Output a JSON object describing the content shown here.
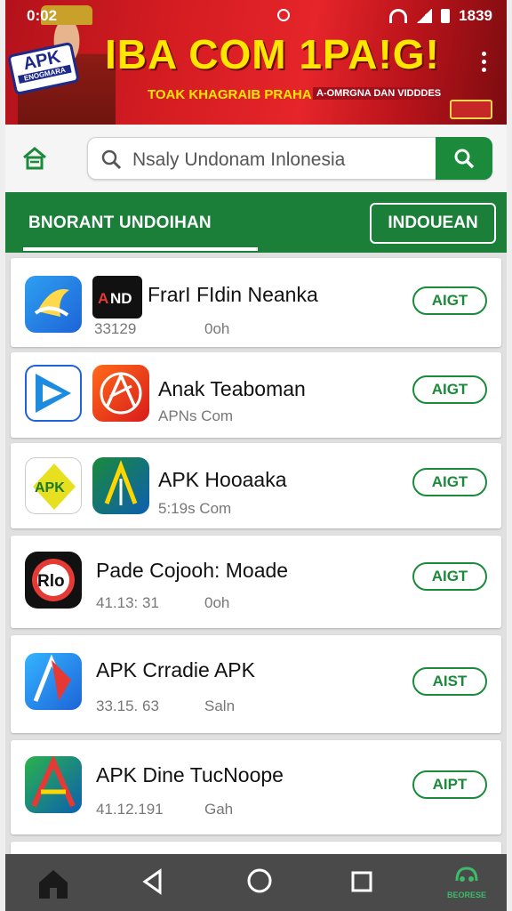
{
  "status_bar": {
    "time": "0:02",
    "clock_right": "1839"
  },
  "banner": {
    "logo_text": "APK",
    "logo_subtext": "ENOGMARA",
    "title": "IBA COM 1PA!G!",
    "subtitle": "TOAK KHAGRAIB PRAHA",
    "subtitle_right": "A-OMRGNA DAN VIDDDES"
  },
  "search": {
    "placeholder": "Nsaly Undonam Inlonesia"
  },
  "tabs": {
    "active_label": "BNORANT UNDOIHAN",
    "button_label": "INDOUEAN"
  },
  "apps": [
    {
      "name": "FrarI FIdin Neanka",
      "meta": "33129",
      "meta2": "0oh",
      "action": "AIGT",
      "icon": "blue-bird-icon",
      "icon2": "and-logo-icon"
    },
    {
      "name": "Anak Teaboman",
      "meta": "APNs Com",
      "meta2": "",
      "action": "AIGT",
      "icon": "blue-play-icon",
      "icon2": "red-compass-icon"
    },
    {
      "name": "APK Hooaaka",
      "meta": "5:19s Com",
      "meta2": "",
      "action": "AIGT",
      "icon": "apk-yellow-icon",
      "icon2": "green-arrow-icon"
    },
    {
      "name": "Pade Cojooh: Moade",
      "meta": "41.13: 31",
      "meta2": "0oh",
      "action": "AIGT",
      "icon": "rlo-icon",
      "icon2": ""
    },
    {
      "name": "APK Crradie APK",
      "meta": "33.15. 63",
      "meta2": "Saln",
      "action": "AIST",
      "icon": "blue-a-icon",
      "icon2": ""
    },
    {
      "name": "APK Dine TucNoope",
      "meta": "41.12.191",
      "meta2": "Gah",
      "action": "AIPT",
      "icon": "green-a-icon",
      "icon2": ""
    }
  ],
  "navbar": {
    "right_label": "BEORESE"
  },
  "colors": {
    "accent_green": "#1b8a3a",
    "banner_red": "#d61d22",
    "banner_yellow": "#ffe600"
  }
}
